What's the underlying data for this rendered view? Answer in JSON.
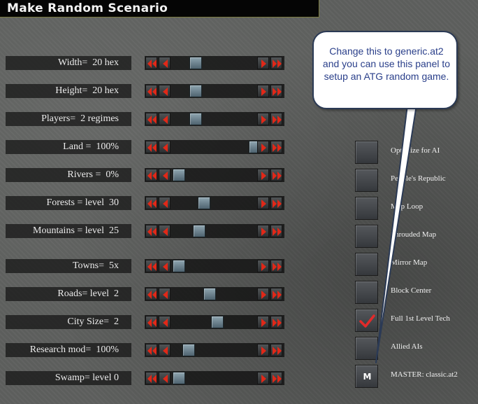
{
  "window": {
    "title": "Make Random Scenario"
  },
  "colors": {
    "arrow_red": "#e02818",
    "knob": "#6f8894",
    "checkmark": "#e22a2a",
    "callout_text": "#2a3f8a"
  },
  "sliders": [
    {
      "label": "Width=  20 hex",
      "level": 0.22
    },
    {
      "label": "Height=  20 hex",
      "level": 0.22
    },
    {
      "label": "Players=  2 regimes",
      "level": 0.22
    },
    {
      "label": "Land =  100%",
      "level": 1.0
    },
    {
      "label": "Rivers =  0%",
      "level": 0.0
    },
    {
      "label": "Forests = level  30",
      "level": 0.33
    },
    {
      "label": "Mountains = level  25",
      "level": 0.27
    },
    {
      "label": "Towns=  5x",
      "level": 0.0
    },
    {
      "label": "Roads= level  2",
      "level": 0.4
    },
    {
      "label": "City Size=  2",
      "level": 0.5
    },
    {
      "label": "Research mod=  100%",
      "level": 0.13
    },
    {
      "label": "Swamp= level 0",
      "level": 0.0
    }
  ],
  "slider_icons": {
    "fast_back": "double-left-arrow-icon",
    "back": "left-arrow-icon",
    "forward": "right-arrow-icon",
    "fast_forward": "double-right-arrow-icon"
  },
  "options": [
    {
      "label": "Optimize for AI",
      "checked": false
    },
    {
      "label": "People's Republic",
      "checked": false
    },
    {
      "label": "Map Loop",
      "checked": false
    },
    {
      "label": "Shrouded Map",
      "checked": false
    },
    {
      "label": "Mirror Map",
      "checked": false
    },
    {
      "label": "Block Center",
      "checked": false
    },
    {
      "label": "Full 1st Level Tech",
      "checked": true
    },
    {
      "label": "Allied AIs",
      "checked": false
    }
  ],
  "master": {
    "button_label": "M",
    "label": "MASTER: classic.at2"
  },
  "callout": {
    "text": "Change this to generic.at2 and you can use this panel to setup an ATG random game."
  }
}
